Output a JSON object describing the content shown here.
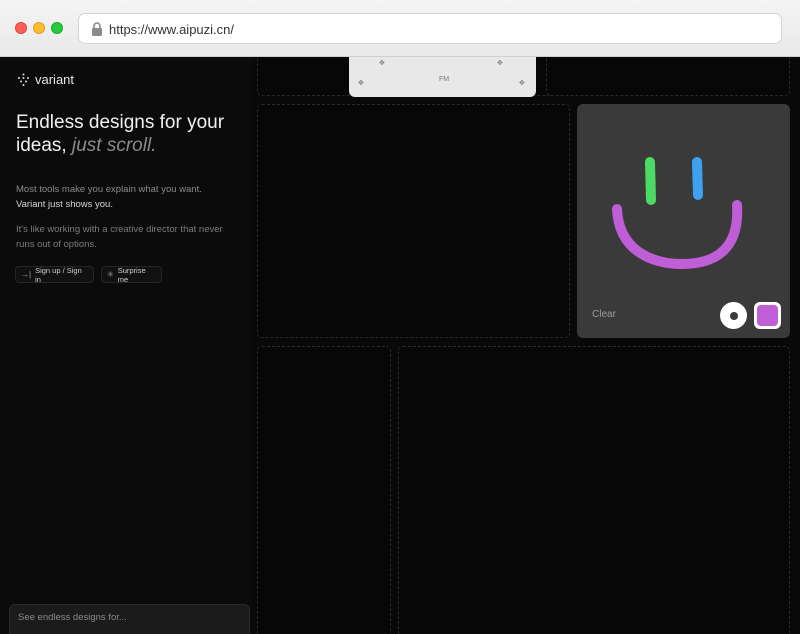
{
  "browser": {
    "url": "https://www.aipuzi.cn/"
  },
  "sidebar": {
    "logo_text": "variant",
    "headline_main": "Endless designs for your ideas,",
    "headline_italic": "just scroll.",
    "paragraph1_plain": "Most tools make you explain what you want.",
    "paragraph1_strong": "Variant just shows you.",
    "paragraph2": "It's like working with a creative director that never runs out of options.",
    "signin_label": "Sign up / Sign in",
    "surprise_label": "Surprise me",
    "search_placeholder": "See endless designs for..."
  },
  "preview": {
    "mark_center": "FM"
  },
  "draw": {
    "clear_label": "Clear",
    "selected_color": "#c05ed8",
    "strokes": {
      "left_eye": "#4cd964",
      "right_eye": "#3fa0ef",
      "smile": "#c05ed8"
    }
  },
  "colors": {
    "page_bg": "#090909",
    "card_bg": "#3a3a3a"
  }
}
